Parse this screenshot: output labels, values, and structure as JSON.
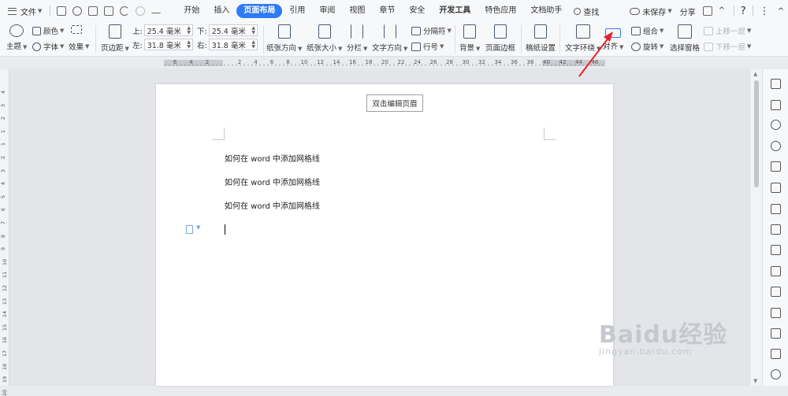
{
  "topbar": {
    "file_label": "文件",
    "tabs": [
      {
        "label": "开始",
        "active": false
      },
      {
        "label": "插入",
        "active": false
      },
      {
        "label": "页面布局",
        "active": true
      },
      {
        "label": "引用",
        "active": false
      },
      {
        "label": "审阅",
        "active": false
      },
      {
        "label": "视图",
        "active": false
      },
      {
        "label": "章节",
        "active": false
      },
      {
        "label": "安全",
        "active": false
      },
      {
        "label": "开发工具",
        "active": false
      },
      {
        "label": "特色应用",
        "active": false
      },
      {
        "label": "文档助手",
        "active": false
      }
    ],
    "search_label": "查找",
    "unsaved_label": "未保存",
    "share_label": "分享",
    "help_label": "?",
    "more_label": "⋮",
    "collapse_label": "^"
  },
  "ribbon": {
    "theme_label": "主题",
    "color_label": "颜色",
    "font_label": "字体",
    "effect_label": "效果",
    "page_bg_label": "",
    "margin_label": "页边距",
    "top_label": "上:",
    "top_value": "25.4 毫米",
    "bottom_label": "下:",
    "bottom_value": "25.4 毫米",
    "left_label": "左:",
    "left_value": "31.8 毫米",
    "right_label": "右:",
    "right_value": "31.8 毫米",
    "orientation_label": "纸张方向",
    "size_label": "纸张大小",
    "columns_label": "分栏",
    "text_direction_label": "文字方向",
    "page_break_label": "分隔符",
    "line_number_label": "行号",
    "background_label": "背景",
    "page_border_label": "页面边框",
    "draft_settings_label": "稿纸设置",
    "text_wrap_label": "文字环绕",
    "align_label": "对齐",
    "group_label": "组合",
    "rotate_label": "旋转",
    "selection_pane_label": "选择窗格",
    "bring_forward_label": "上移一层",
    "send_backward_label": "下移一层"
  },
  "ruler": {
    "numbers": [
      "6",
      "4",
      "2",
      "2",
      "4",
      "6",
      "8",
      "10",
      "12",
      "14",
      "16",
      "18",
      "20",
      "22",
      "24",
      "26",
      "28",
      "30",
      "32",
      "34",
      "36",
      "38",
      "40",
      "42",
      "44",
      "46"
    ]
  },
  "vruler": {
    "numbers": [
      "4",
      "3",
      "2",
      "1",
      "1",
      "2",
      "3",
      "4",
      "5",
      "6",
      "7",
      "8",
      "9",
      "10",
      "11",
      "12",
      "13",
      "14",
      "15",
      "16",
      "17",
      "18",
      "19",
      "20"
    ]
  },
  "document": {
    "header_button": "双击编辑页眉",
    "lines": [
      "如何在 word 中添加网格线",
      "如何在 word 中添加网格线",
      "如何在 word 中添加网格线"
    ]
  },
  "watermark": {
    "brand": "Baidu经验",
    "url": "jingyan.baidu.com"
  },
  "colors": {
    "accent": "#2f7bf5",
    "arrow": "#e8212b"
  }
}
